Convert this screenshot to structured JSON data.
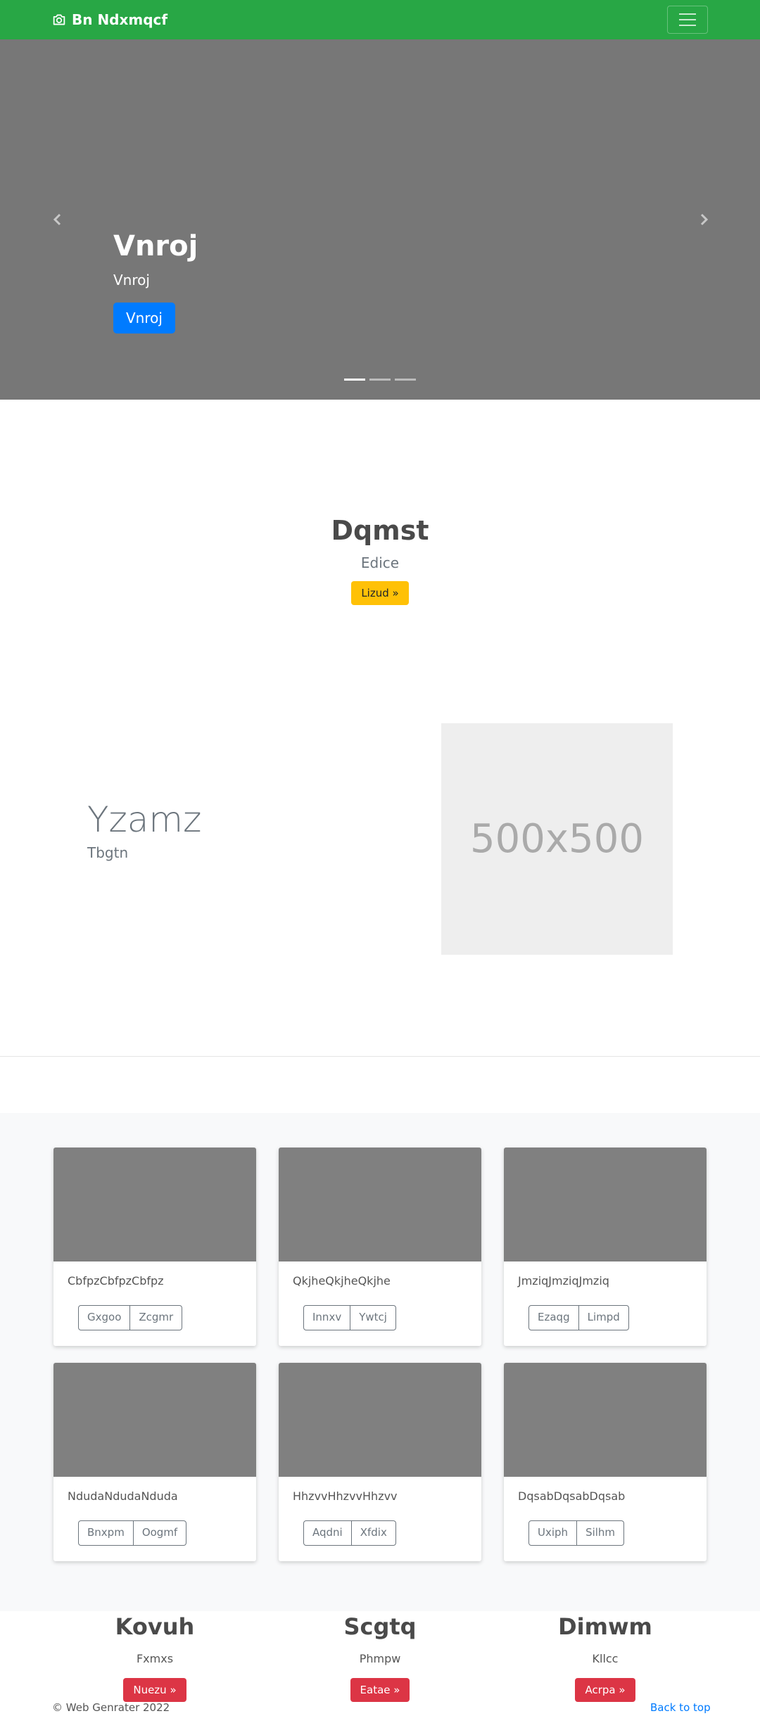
{
  "navbar": {
    "brand": "Bn Ndxmqcf"
  },
  "carousel": {
    "title": "Vnroj",
    "subtitle": "Vnroj",
    "button": "Vnroj",
    "indicator_count": 3,
    "active_indicator": 1
  },
  "hero": {
    "title": "Dqmst",
    "subtitle": "Edice",
    "button": "Lizud »"
  },
  "feature": {
    "title": "Yzamz",
    "subtitle": "Tbgtn",
    "placeholder": "500x500"
  },
  "album": {
    "cards": [
      {
        "text": "CbfpzCbfpzCbfpz",
        "btn1": "Gxgoo",
        "btn2": "Zcgmr"
      },
      {
        "text": "QkjheQkjheQkjhe",
        "btn1": "Innxv",
        "btn2": "Ywtcj"
      },
      {
        "text": "JmziqJmziqJmziq",
        "btn1": "Ezaqg",
        "btn2": "Limpd"
      },
      {
        "text": "NdudaNdudaNduda",
        "btn1": "Bnxpm",
        "btn2": "Oogmf"
      },
      {
        "text": "HhzvvHhzvvHhzvv",
        "btn1": "Aqdni",
        "btn2": "Xfdix"
      },
      {
        "text": "DqsabDqsabDqsab",
        "btn1": "Uxiph",
        "btn2": "Silhm"
      }
    ]
  },
  "columns": [
    {
      "title": "Kovuh",
      "subtitle": "Fxmxs",
      "button": "Nuezu »"
    },
    {
      "title": "Scgtq",
      "subtitle": "Phmpw",
      "button": "Eatae »"
    },
    {
      "title": "Dimwm",
      "subtitle": "Kllcc",
      "button": "Acrpa »"
    }
  ],
  "footer": {
    "copyright": "© Web Genrater 2022",
    "back_to_top": "Back to top"
  },
  "colors": {
    "navbar": "#28a745",
    "primary": "#007bff",
    "warning": "#ffc107",
    "danger": "#dc3545"
  }
}
